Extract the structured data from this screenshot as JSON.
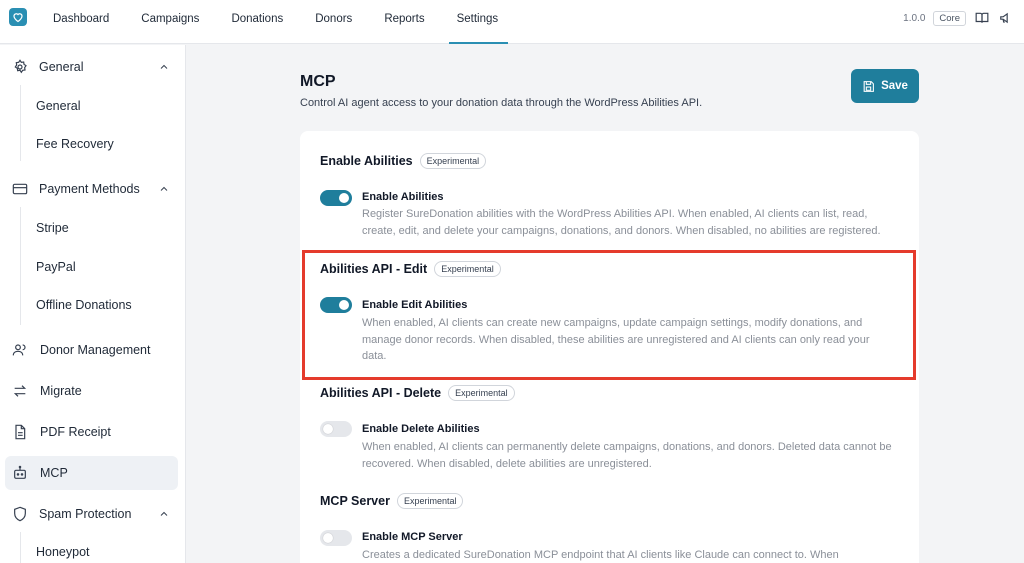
{
  "nav": [
    "Dashboard",
    "Campaigns",
    "Donations",
    "Donors",
    "Reports",
    "Settings"
  ],
  "active_nav": "Settings",
  "version": "1.0.0",
  "core_badge": "Core",
  "sidebar": {
    "groups": [
      {
        "label": "General",
        "icon": "gear-icon",
        "items": [
          "General",
          "Fee Recovery"
        ]
      },
      {
        "label": "Payment Methods",
        "icon": "card-icon",
        "items": [
          "Stripe",
          "PayPal",
          "Offline Donations"
        ]
      },
      {
        "label": "Donor Management",
        "icon": "users-icon"
      },
      {
        "label": "Migrate",
        "icon": "arrows-icon"
      },
      {
        "label": "PDF Receipt",
        "icon": "document-icon"
      },
      {
        "label": "MCP",
        "icon": "robot-icon"
      },
      {
        "label": "Spam Protection",
        "icon": "shield-icon",
        "items": [
          "Honeypot"
        ]
      }
    ]
  },
  "main": {
    "title": "MCP",
    "description": "Control AI agent access to your donation data through the WordPress Abilities API.",
    "save_label": "Save",
    "sections": [
      {
        "title": "Enable Abilities",
        "badge": "Experimental",
        "option": "Enable Abilities",
        "enabled": true,
        "description": "Register SureDonation abilities with the WordPress Abilities API. When enabled, AI clients can list, read, create, edit, and delete your campaigns, donations, and donors. When disabled, no abilities are registered."
      },
      {
        "title": "Abilities API - Edit",
        "badge": "Experimental",
        "option": "Enable Edit Abilities",
        "enabled": true,
        "description": "When enabled, AI clients can create new campaigns, update campaign settings, modify donations, and manage donor records. When disabled, these abilities are unregistered and AI clients can only read your data."
      },
      {
        "title": "Abilities API - Delete",
        "badge": "Experimental",
        "option": "Enable Delete Abilities",
        "enabled": false,
        "description": "When enabled, AI clients can permanently delete campaigns, donations, and donors. Deleted data cannot be recovered. When disabled, delete abilities are unregistered."
      },
      {
        "title": "MCP Server",
        "badge": "Experimental",
        "option": "Enable MCP Server",
        "enabled": false,
        "description": "Creates a dedicated SureDonation MCP endpoint that AI clients like Claude can connect to. When"
      }
    ]
  },
  "colors": {
    "accent": "#1f7e9c",
    "highlight": "#e53b2c"
  }
}
